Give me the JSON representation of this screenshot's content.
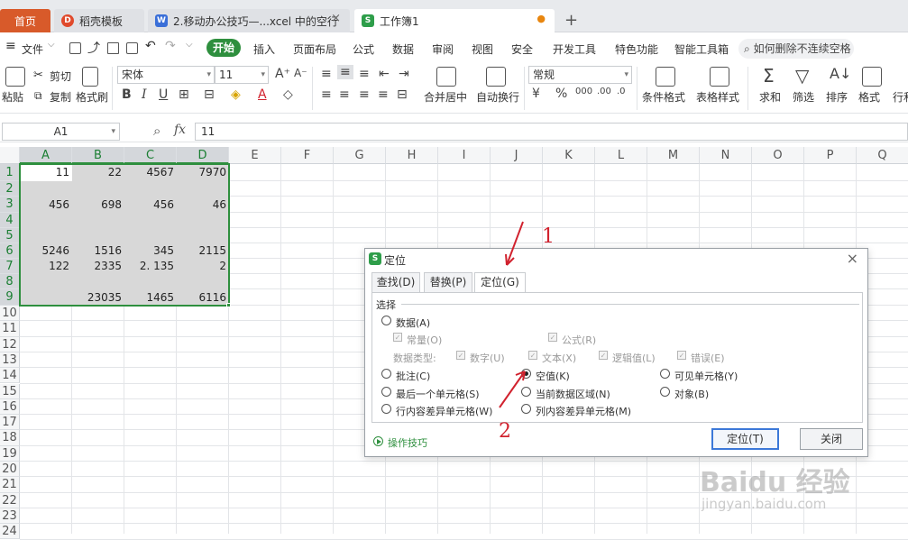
{
  "tabs": [
    {
      "label": "首页"
    },
    {
      "label": "稻壳模板"
    },
    {
      "label": "2.移动办公技巧—...xcel 中的空行"
    },
    {
      "label": "工作簿1"
    }
  ],
  "menubar": {
    "file": "文件",
    "items": [
      "开始",
      "插入",
      "页面布局",
      "公式",
      "数据",
      "审阅",
      "视图",
      "安全",
      "开发工具",
      "特色功能",
      "智能工具箱"
    ],
    "search_placeholder": "如何删除不连续空格"
  },
  "ribbon": {
    "paste": "粘贴",
    "cut": "剪切",
    "copy": "复制",
    "format_painter": "格式刷",
    "font_name": "宋体",
    "font_size": "11",
    "bold": "B",
    "italic": "I",
    "underline": "U",
    "merge_center": "合并居中",
    "wrap": "自动换行",
    "number_format": "常规",
    "percent": "%",
    "cond_format": "条件格式",
    "table_style": "表格样式",
    "sum": "求和",
    "filter": "筛选",
    "sort": "排序",
    "format": "格式",
    "rows_cols": "行和"
  },
  "formula": {
    "cell_ref": "A1",
    "fx": "fx",
    "value": "11"
  },
  "grid": {
    "columns": [
      "A",
      "B",
      "C",
      "D",
      "E",
      "F",
      "G",
      "H",
      "I",
      "J",
      "K",
      "L",
      "M",
      "N",
      "O",
      "P",
      "Q"
    ],
    "rows": [
      "1",
      "2",
      "3",
      "4",
      "5",
      "6",
      "7",
      "8",
      "9",
      "10",
      "11",
      "12",
      "13",
      "14",
      "15",
      "16",
      "17",
      "18",
      "19",
      "20",
      "21",
      "22",
      "23",
      "24"
    ],
    "cells": [
      {
        "ref": "A1",
        "v": "11"
      },
      {
        "ref": "B1",
        "v": "22"
      },
      {
        "ref": "C1",
        "v": "4567"
      },
      {
        "ref": "D1",
        "v": "7970"
      },
      {
        "ref": "A3",
        "v": "456"
      },
      {
        "ref": "B3",
        "v": "698"
      },
      {
        "ref": "C3",
        "v": "456"
      },
      {
        "ref": "D3",
        "v": "46"
      },
      {
        "ref": "A6",
        "v": "5246"
      },
      {
        "ref": "B6",
        "v": "1516"
      },
      {
        "ref": "C6",
        "v": "345"
      },
      {
        "ref": "D6",
        "v": "2115"
      },
      {
        "ref": "A7",
        "v": "122"
      },
      {
        "ref": "B7",
        "v": "2335"
      },
      {
        "ref": "C7",
        "v": "2. 135"
      },
      {
        "ref": "D7",
        "v": "2"
      },
      {
        "ref": "B9",
        "v": "23035"
      },
      {
        "ref": "C9",
        "v": "1465"
      },
      {
        "ref": "D9",
        "v": "6116"
      }
    ]
  },
  "dialog": {
    "title": "定位",
    "tabs": [
      "查找(D)",
      "替换(P)",
      "定位(G)"
    ],
    "active_tab": "定位(G)",
    "section": "选择",
    "data": "数据(A)",
    "constants": "常量(O)",
    "formulas": "公式(R)",
    "data_type": "数据类型:",
    "number": "数字(U)",
    "text": "文本(X)",
    "logical": "逻辑值(L)",
    "error": "错误(E)",
    "comments": "批注(C)",
    "blanks": "空值(K)",
    "visible_cells": "可见单元格(Y)",
    "last_cell": "最后一个单元格(S)",
    "current_region": "当前数据区域(N)",
    "objects": "对象(B)",
    "row_diff": "行内容差异单元格(W)",
    "col_diff": "列内容差异单元格(M)",
    "selected_option": "空值(K)",
    "tips": "操作技巧",
    "locate_button": "定位(T)",
    "close_button": "关闭"
  },
  "annotations": {
    "one": "1",
    "two": "2"
  },
  "watermark": {
    "brand": "Baidu 经验",
    "url": "jingyan.baidu.com"
  },
  "colors": {
    "accent": "#2e8f3e",
    "home_tab": "#d85a2a",
    "annotation": "#d1222e",
    "selection": "#d8d8d8"
  }
}
